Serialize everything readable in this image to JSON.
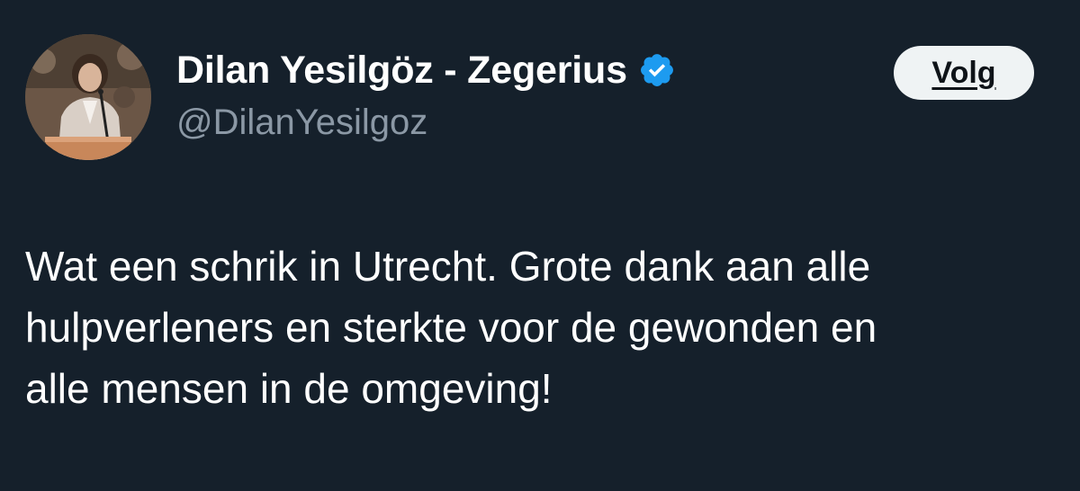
{
  "author": {
    "display_name": "Dilan Yesilgöz - Zegerius",
    "handle": "@DilanYesilgoz",
    "verified": true,
    "verified_badge_color": "#1d9bf0",
    "avatar_icon": "profile-photo"
  },
  "follow_button": {
    "label": "Volg"
  },
  "tweet": {
    "text": "Wat een schrik in Utrecht. Grote dank aan alle\nhulpverleners en sterkte voor de gewonden en\nalle mensen in de omgeving!"
  },
  "colors": {
    "background": "#15202b",
    "primary_text": "#ffffff",
    "secondary_text": "#8b98a5",
    "button_bg": "#eff3f4",
    "button_text": "#0f1419"
  }
}
